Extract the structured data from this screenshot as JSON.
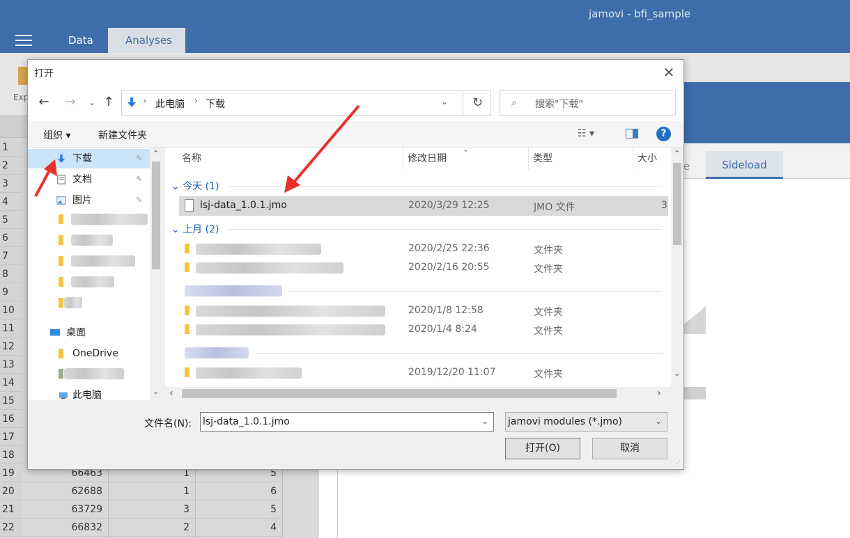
{
  "app": {
    "title": "jamovi - bfi_sample",
    "tabs": [
      "Data",
      "Analyses"
    ],
    "export_label": "Exp",
    "results_tabs": [
      "e",
      "Sideload"
    ]
  },
  "sheet": {
    "row_numbers": [
      "1",
      "2",
      "3",
      "4",
      "5",
      "6",
      "7",
      "8",
      "9",
      "10",
      "11",
      "12",
      "13",
      "14",
      "15",
      "16",
      "17",
      "18",
      "19",
      "20",
      "21",
      "22"
    ],
    "visible_rows": [
      {
        "num": "19",
        "c1": "66463",
        "c2": "1",
        "c3": "5"
      },
      {
        "num": "20",
        "c1": "62688",
        "c2": "1",
        "c3": "6"
      },
      {
        "num": "21",
        "c1": "63729",
        "c2": "3",
        "c3": "5"
      },
      {
        "num": "22",
        "c1": "66832",
        "c2": "2",
        "c3": "4"
      }
    ]
  },
  "dialog": {
    "title": "打开",
    "close_glyph": "✕",
    "nav": {
      "back": "←",
      "forward": "→",
      "recent": "⌄",
      "up": "↑",
      "breadcrumb": [
        "此电脑",
        "下载"
      ],
      "separator": "›",
      "refresh": "↻",
      "dropdown": "⌄"
    },
    "search": {
      "placeholder": "搜索\"下载\"",
      "icon": "search-icon"
    },
    "toolbar": {
      "organize": "组织 ▾",
      "new_folder": "新建文件夹",
      "view": "☷ ▾",
      "help": "?"
    },
    "nav_pane": {
      "items": [
        {
          "label": "下载",
          "icon": "download-icon",
          "pinned": true
        },
        {
          "label": "文档",
          "icon": "document-icon",
          "pinned": true
        },
        {
          "label": "图片",
          "icon": "picture-icon",
          "pinned": true
        },
        {
          "label": "桌面",
          "icon": "desktop-icon",
          "pinned": false
        },
        {
          "label": "OneDrive",
          "icon": "folder-icon",
          "pinned": false
        },
        {
          "label": "此电脑",
          "icon": "computer-icon",
          "pinned": false
        }
      ],
      "pin_glyph": "📌"
    },
    "columns": [
      "名称",
      "修改日期",
      "类型",
      "大小"
    ],
    "groups": [
      {
        "label": "今天 (1)"
      },
      {
        "label": "上月 (2)"
      }
    ],
    "files": [
      {
        "name": "lsj-data_1.0.1.jmo",
        "date": "2020/3/29 12:25",
        "type": "JMO 文件",
        "size": "3",
        "selected": true
      },
      {
        "name": "",
        "date": "2020/2/25 22:36",
        "type": "文件夹",
        "size": ""
      },
      {
        "name": "",
        "date": "2020/2/16 20:55",
        "type": "文件夹",
        "size": ""
      },
      {
        "name": "",
        "date": "2020/1/8 12:58",
        "type": "文件夹",
        "size": ""
      },
      {
        "name": "",
        "date": "2020/1/4 8:24",
        "type": "文件夹",
        "size": ""
      },
      {
        "name": "",
        "date": "2019/12/20 11:07",
        "type": "文件夹",
        "size": ""
      }
    ],
    "filename": {
      "label": "文件名(N):",
      "value": "lsj-data_1.0.1.jmo"
    },
    "filetype": {
      "value": "jamovi modules (*.jmo)"
    },
    "buttons": {
      "open": "打开(O)",
      "cancel": "取消"
    },
    "dropdown_arrow": "⌄",
    "scroll_up": "⌃",
    "scroll_down": "⌄",
    "scroll_left": "‹",
    "scroll_right": "›"
  },
  "colors": {
    "titlebar": "#3e6da9",
    "selection": "#cce4f7",
    "annotation_arrow": "#e8302a"
  }
}
